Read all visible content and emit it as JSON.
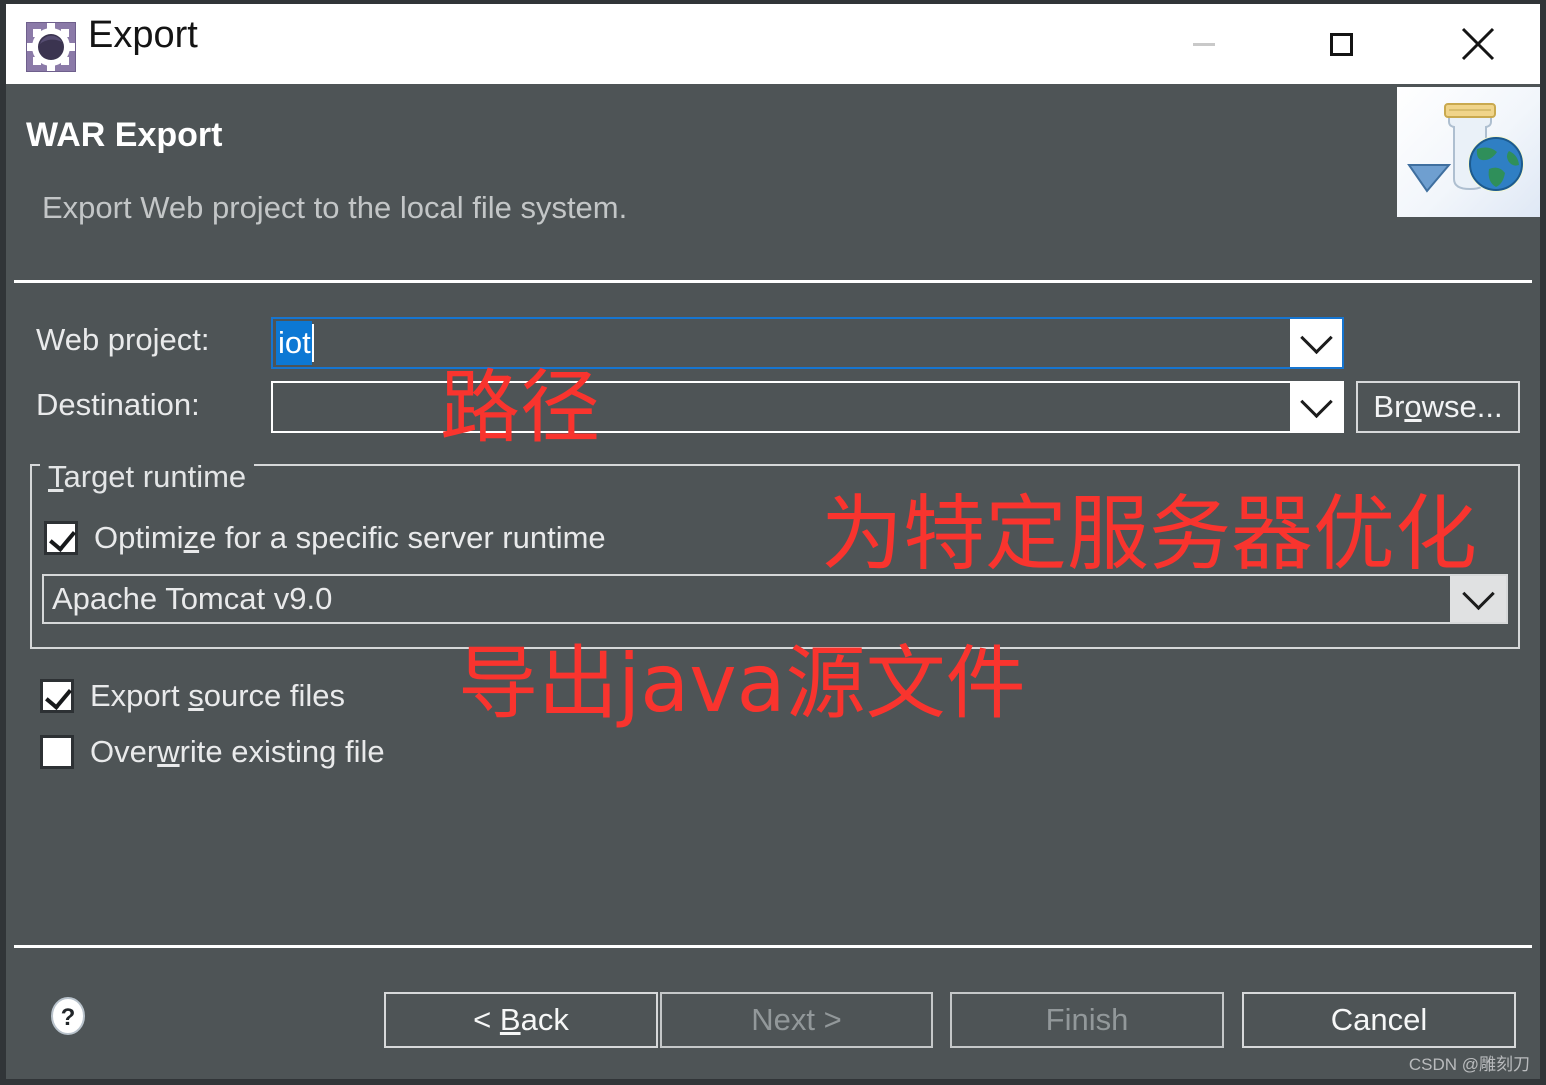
{
  "window": {
    "title": "Export",
    "icon": "eclipse-export-icon",
    "controls": {
      "minimize": "minimize-icon",
      "maximize": "maximize-icon",
      "close": "close-icon"
    }
  },
  "header": {
    "title": "WAR Export",
    "subtitle": "Export Web project to the local file system.",
    "banner_icon": "war-jar-globe-icon"
  },
  "form": {
    "web_project": {
      "label": "Web project:",
      "value": "iot",
      "placeholder": ""
    },
    "destination": {
      "label": "Destination:",
      "value": "",
      "placeholder": ""
    },
    "browse_label": "Browse...",
    "browse_mnemonic": "o",
    "target_runtime": {
      "legend": "Target runtime",
      "legend_mnemonic": "T",
      "optimize": {
        "label": "Optimize for a specific server runtime",
        "mnemonic": "z",
        "checked": true
      },
      "runtime_value": "Apache Tomcat v9.0"
    },
    "export_source": {
      "label": "Export source files",
      "mnemonic": "s",
      "checked": true
    },
    "overwrite": {
      "label": "Overwrite existing file",
      "mnemonic": "w",
      "checked": false
    }
  },
  "footer": {
    "help_icon": "help-question-icon",
    "buttons": [
      {
        "label": "< Back",
        "mnemonic": "B",
        "enabled": true
      },
      {
        "label": "Next >",
        "mnemonic": "N",
        "enabled": false
      },
      {
        "label": "Finish",
        "mnemonic": "F",
        "enabled": false
      },
      {
        "label": "Cancel",
        "mnemonic": "C",
        "enabled": true
      }
    ]
  },
  "annotations": [
    {
      "text": "路径",
      "color": "#f9342e"
    },
    {
      "text": "为特定服务器优化",
      "color": "#f9342e"
    },
    {
      "text": "导出java源文件",
      "color": "#f9342e"
    }
  ],
  "watermark": "CSDN @雕刻刀",
  "colors": {
    "dialog_bg": "#4e5456",
    "titlebar_bg": "#ffffff",
    "accent_focus": "#1675d0",
    "selection_bg": "#0c78d4",
    "annotation_red": "#f9342e"
  }
}
